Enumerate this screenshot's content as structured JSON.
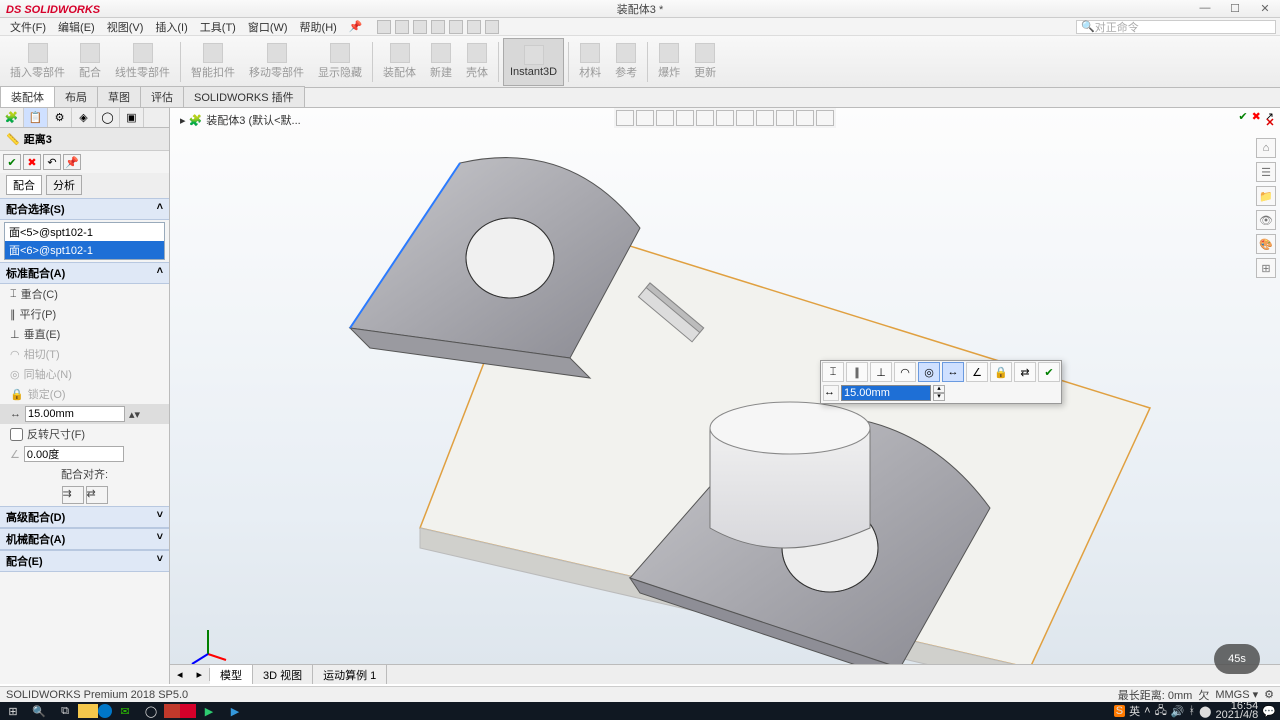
{
  "app": {
    "name": "SOLIDWORKS",
    "doc_title": "装配体3 *"
  },
  "menu": [
    "文件(F)",
    "编辑(E)",
    "视图(V)",
    "插入(I)",
    "工具(T)",
    "窗口(W)",
    "帮助(H)"
  ],
  "search_placeholder": "对正命令",
  "ribbon": {
    "items": [
      "插入零部件",
      "配合",
      "线性零部件",
      "智能扣件",
      "移动零部件",
      "显示隐藏",
      "装配体",
      "新建",
      "壳体",
      "Instant3D",
      "材料",
      "参考",
      "爆炸",
      "更新"
    ],
    "active": "Instant3D"
  },
  "cmd_tabs": [
    "装配体",
    "布局",
    "草图",
    "评估",
    "SOLIDWORKS 插件"
  ],
  "breadcrumb": "装配体3 (默认<默...",
  "pm": {
    "title": "距离3",
    "tabs_mini": [
      "配合",
      "分析"
    ],
    "sections": {
      "selections": "配合选择(S)",
      "standard": "标准配合(A)"
    },
    "selected": [
      "面<5>@spt102-1",
      "面<6>@spt102-1"
    ],
    "mate_opts": [
      "重合(C)",
      "平行(P)",
      "垂直(E)",
      "相切(T)",
      "同轴心(N)",
      "锁定(O)"
    ],
    "distance_value": "15.00mm",
    "flip_label": "反转尺寸(F)",
    "angle_value": "0.00度",
    "align_label": "配合对齐:",
    "groups": [
      "高级配合(D)",
      "机械配合(A)",
      "配合(E)"
    ]
  },
  "context_toolbar": {
    "value": "15.00mm"
  },
  "bottom_tabs": [
    "模型",
    "3D 视图",
    "运动算例 1"
  ],
  "status": {
    "left": "SOLIDWORKS Premium 2018 SP5.0",
    "right_dist": "最长距离: 0mm"
  },
  "taskbar": {
    "time": "16:54",
    "date": "2021/4/8"
  },
  "overlay_pill": "45s"
}
